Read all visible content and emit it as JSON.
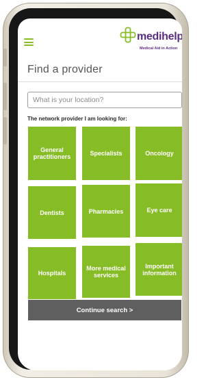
{
  "brand": {
    "name": "medihelp",
    "tagline": "Medical Aid in Action",
    "color": "#5b2d82",
    "accent": "#86bc25",
    "logo_icon": "medihelp-cross-logo"
  },
  "header": {
    "menu_icon": "hamburger-menu-icon"
  },
  "page": {
    "title": "Find a provider",
    "search_placeholder": "What is your location?",
    "search_value": "",
    "subtitle": "The network provider I am looking for:"
  },
  "tiles": [
    {
      "label": "General practitioners"
    },
    {
      "label": "Specialists"
    },
    {
      "label": "Oncology"
    },
    {
      "label": "Dentists"
    },
    {
      "label": "Pharmacies"
    },
    {
      "label": "Eye care"
    },
    {
      "label": "Hospitals"
    },
    {
      "label": "More medical services"
    },
    {
      "label": "Important information"
    }
  ],
  "continue_button": {
    "label": "Continue search >",
    "color": "#5f5f5f"
  }
}
